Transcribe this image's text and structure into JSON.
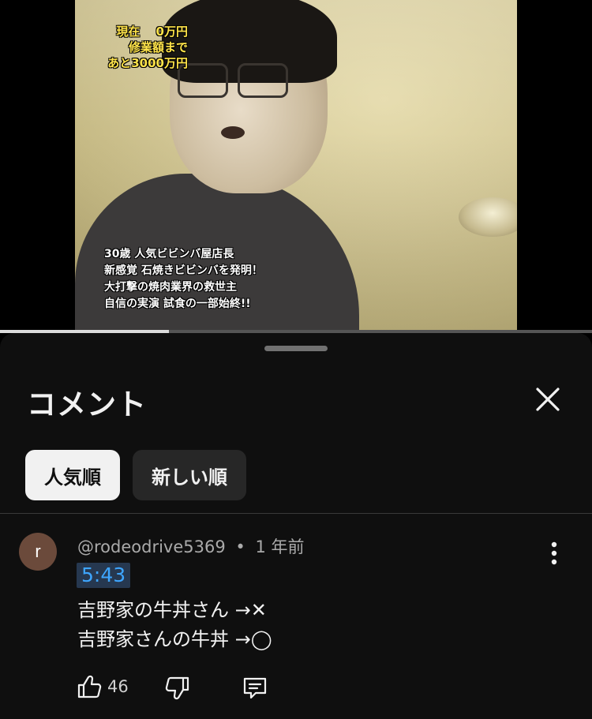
{
  "video": {
    "caption_top": "現在　 0万円\n修業額まで\nあと3000万円",
    "caption_bottom": "30歳 人気ビビンバ屋店長\n新感覚 石焼きビビンバを発明！\n大打撃の焼肉業界の救世主\n自信の実演 試食の一部始終!!",
    "progress_percent": 28.5
  },
  "panel": {
    "title": "コメント",
    "sort_chips": [
      {
        "label": "人気順",
        "active": true
      },
      {
        "label": "新しい順",
        "active": false
      }
    ]
  },
  "comment": {
    "avatar_letter": "r",
    "author": "@rodeodrive5369",
    "separator": "•",
    "time_ago": "1 年前",
    "timestamp_link": "5:43",
    "lines": [
      "吉野家の牛丼さん →✕",
      "吉野家さんの牛丼 →◯"
    ],
    "like_count": "46"
  },
  "icons": {
    "close": "close-icon",
    "more": "more-vert-icon",
    "like": "thumbs-up-icon",
    "dislike": "thumbs-down-icon",
    "reply": "reply-comment-icon"
  },
  "colors": {
    "panel_bg": "#0f0f0f",
    "chip_active_bg": "#f1f1f1",
    "chip_inactive_bg": "#272727",
    "link_blue": "#3ea6ff",
    "timestamp_bg": "#263850",
    "avatar_bg": "#6b4a3b"
  }
}
